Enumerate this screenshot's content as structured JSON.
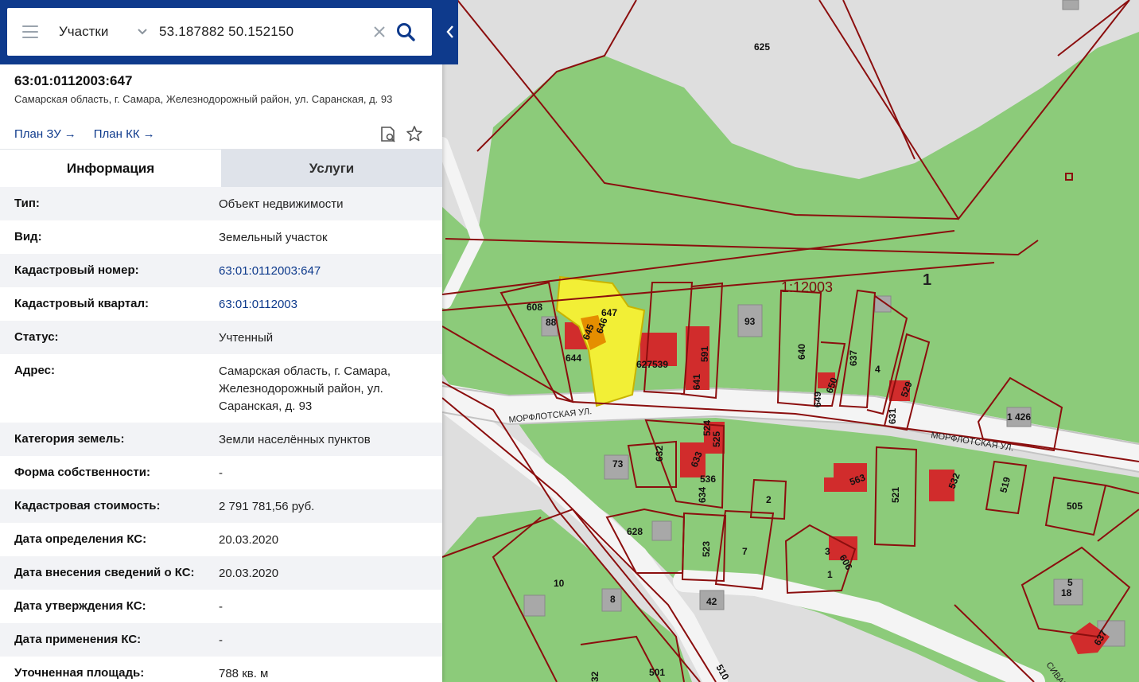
{
  "search": {
    "category": "Участки",
    "query": "53.187882 50.152150"
  },
  "parcel": {
    "cadastral_number": "63:01:0112003:647",
    "address": "Самарская область, г. Самара, Железнодорожный район, ул. Саранская, д. 93"
  },
  "links": {
    "plan_zu": "План ЗУ",
    "plan_kk": "План КК"
  },
  "tabs": [
    {
      "label": "Информация",
      "active": true
    },
    {
      "label": "Услуги",
      "active": false
    }
  ],
  "rows": [
    {
      "key": "Тип:",
      "value": "Объект недвижимости"
    },
    {
      "key": "Вид:",
      "value": "Земельный участок"
    },
    {
      "key": "Кадастровый номер:",
      "value": "63:01:0112003:647",
      "link": true
    },
    {
      "key": "Кадастровый квартал:",
      "value": "63:01:0112003",
      "link": true
    },
    {
      "key": "Статус:",
      "value": "Учтенный"
    },
    {
      "key": "Адрес:",
      "value": "Самарская область, г. Самара, Железнодорожный район, ул. Саранская, д. 93"
    },
    {
      "key": "Категория земель:",
      "value": "Земли населённых пунктов"
    },
    {
      "key": "Форма собственности:",
      "value": "-"
    },
    {
      "key": "Кадастровая стоимость:",
      "value": "2 791 781,56 руб."
    },
    {
      "key": "Дата определения КС:",
      "value": "20.03.2020"
    },
    {
      "key": "Дата внесения сведений о КС:",
      "value": "20.03.2020"
    },
    {
      "key": "Дата утверждения КС:",
      "value": "-"
    },
    {
      "key": "Дата применения КС:",
      "value": "-"
    },
    {
      "key": "Уточненная площадь:",
      "value": "788 кв. м"
    }
  ],
  "map": {
    "street_labels": [
      "МОРФЛОТСКАЯ УЛ.",
      "МОРФЛОТСКАЯ УЛ.",
      "СИВАШ"
    ],
    "quarter_label": "1:12003",
    "big_label": "1",
    "parcel_labels": [
      "625",
      "608",
      "88",
      "647",
      "646",
      "645",
      "644",
      "627",
      "539",
      "591",
      "641",
      "93",
      "640",
      "637",
      "4",
      "649",
      "650",
      "529",
      "631",
      "1 426",
      "632",
      "524",
      "525",
      "633",
      "536",
      "634",
      "73",
      "563",
      "521",
      "532",
      "519",
      "505",
      "2",
      "628",
      "523",
      "7",
      "3",
      "606",
      "1",
      "10",
      "8",
      "42",
      "5",
      "18",
      "637",
      "501",
      "510",
      "32"
    ],
    "colors": {
      "green": "#8ccb7a",
      "boundary": "#8b0e0e",
      "building": "#d12c2c",
      "selected": "#f2ef36"
    }
  }
}
